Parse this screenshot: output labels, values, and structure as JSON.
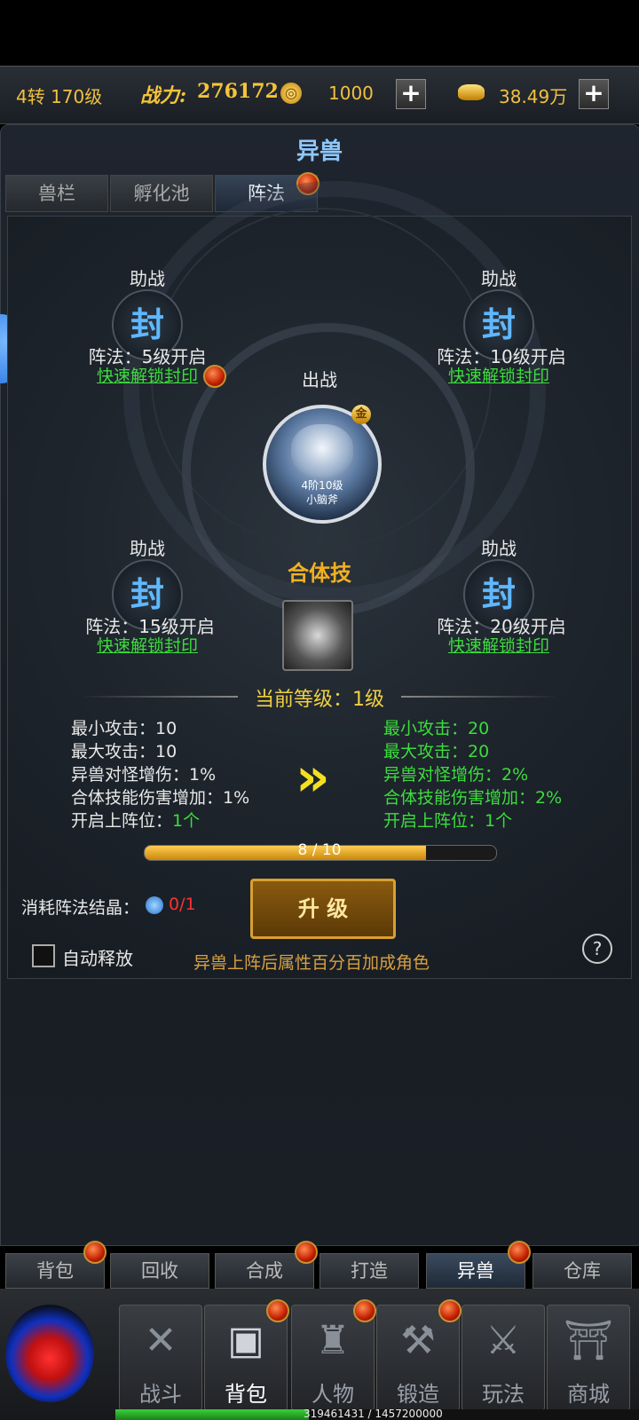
{
  "topbar": {
    "level": "4转 170级",
    "power_label": "战力:",
    "power_value": "276172",
    "currency1": "1000",
    "currency2": "38.49万",
    "plus": "+"
  },
  "panel": {
    "title": "异兽",
    "tabs": [
      "兽栏",
      "孵化池",
      "阵法"
    ]
  },
  "formation": {
    "slots": [
      {
        "label": "助战",
        "seal": "封",
        "req": "阵法：5级开启",
        "link": "快速解锁封印"
      },
      {
        "label": "助战",
        "seal": "封",
        "req": "阵法：10级开启",
        "link": "快速解锁封印"
      },
      {
        "label": "助战",
        "seal": "封",
        "req": "阵法：15级开启",
        "link": "快速解锁封印"
      },
      {
        "label": "助战",
        "seal": "封",
        "req": "阵法：20级开启",
        "link": "快速解锁封印"
      }
    ],
    "main": {
      "label": "出战",
      "stage": "4阶10级",
      "name": "小脑斧",
      "badge": "金"
    },
    "combo_title": "合体技",
    "current_level": "当前等级：1级"
  },
  "stats": {
    "current": [
      "最小攻击：10",
      "最大攻击：10",
      "异兽对怪增伤：1%",
      "合体技能伤害增加：1%"
    ],
    "current_slot_label": "开启上阵位：",
    "current_slot_value": "1个",
    "next": [
      "最小攻击：20",
      "最大攻击：20",
      "异兽对怪增伤：2%",
      "合体技能伤害增加：2%",
      "开启上阵位：1个"
    ]
  },
  "progress": {
    "text": "8 / 10",
    "fraction": 0.8
  },
  "upgrade": {
    "cost_label": "消耗阵法结晶：",
    "cost_value": "0/1",
    "button": "升 级",
    "auto_label": "自动释放",
    "hint": "异兽上阵后属性百分百加成角色",
    "help": "?"
  },
  "subtabs": [
    "背包",
    "回收",
    "合成",
    "打造",
    "异兽",
    "仓库"
  ],
  "nav": [
    "战斗",
    "背包",
    "人物",
    "锻造",
    "玩法",
    "商城"
  ],
  "exp_text": "319461431 / 1457200000",
  "colors": {
    "accent": "#f0c040",
    "green": "#3ddc3d",
    "blue_title": "#8ec8ff"
  }
}
